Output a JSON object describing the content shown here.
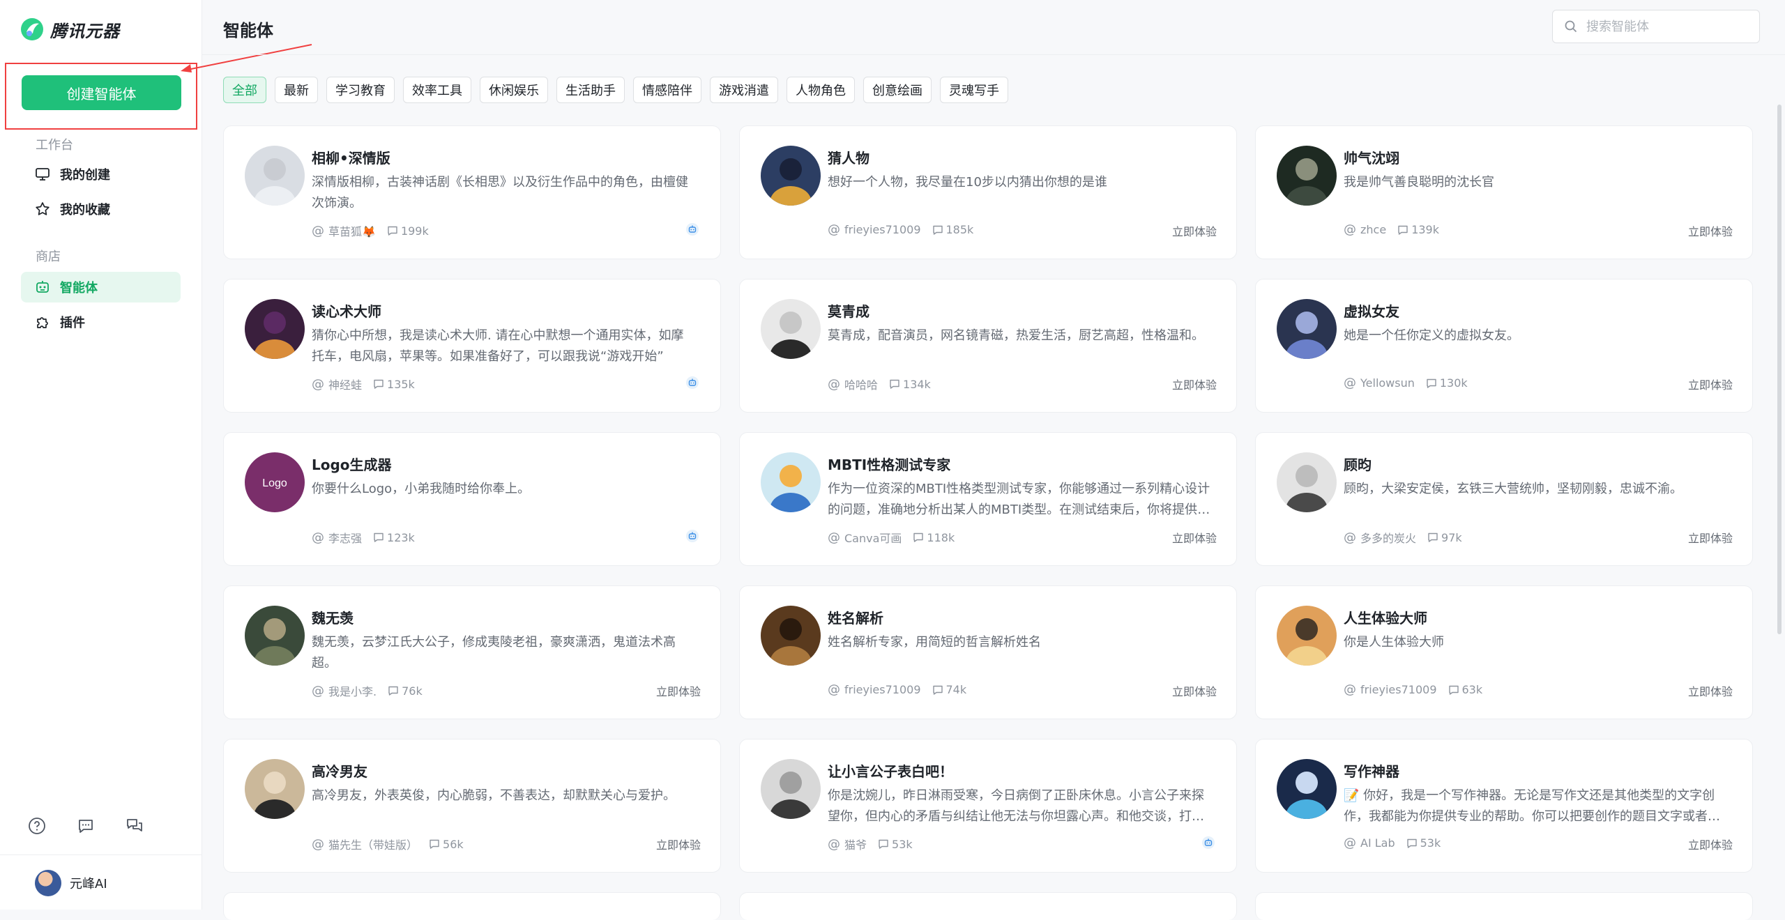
{
  "brand": {
    "name": "腾讯元器"
  },
  "sidebar": {
    "create_label": "创建智能体",
    "workspace_label": "工作台",
    "my_creations": "我的创建",
    "my_favorites": "我的收藏",
    "store_label": "商店",
    "agents": "智能体",
    "plugins": "插件",
    "user_name": "元峰AI",
    "accent": "#1fc07a"
  },
  "header": {
    "title": "智能体",
    "search_placeholder": "搜索智能体"
  },
  "filters": [
    "全部",
    "最新",
    "学习教育",
    "效率工具",
    "休闲娱乐",
    "生活助手",
    "情感陪伴",
    "游戏消遣",
    "人物角色",
    "创意绘画",
    "灵魂写手"
  ],
  "try_label": "立即体验",
  "cards": [
    {
      "name": "相柳•深情版",
      "desc": "深情版相柳，古装神话剧《长相思》以及衍生作品中的角色，由檀健次饰演。",
      "author": "草苗狐🦊",
      "count": "199k",
      "action": "badge"
    },
    {
      "name": "猜人物",
      "desc": "想好一个人物，我尽量在10步以内猜出你想的是谁",
      "author": "frieyies71009",
      "count": "185k",
      "action": "try"
    },
    {
      "name": "帅气沈翊",
      "desc": "我是帅气善良聪明的沈长官",
      "author": "zhce",
      "count": "139k",
      "action": "try"
    },
    {
      "name": "读心术大师",
      "desc": "猜你心中所想，我是读心术大师. 请在心中默想一个通用实体，如摩托车，电风扇，苹果等。如果准备好了，可以跟我说“游戏开始”",
      "author": "神经蛙",
      "count": "135k",
      "action": "badge"
    },
    {
      "name": "莫青成",
      "desc": "莫青成，配音演员，网名镜青磁，热爱生活，厨艺高超，性格温和。",
      "author": "哈哈哈",
      "count": "134k",
      "action": "try"
    },
    {
      "name": "虚拟女友",
      "desc": "她是一个任你定义的虚拟女友。",
      "author": "Yellowsun",
      "count": "130k",
      "action": "try"
    },
    {
      "name": "Logo生成器",
      "desc": "你要什么Logo，小弟我随时给你奉上。",
      "author": "李志强",
      "count": "123k",
      "action": "badge",
      "logo_text": "Logo"
    },
    {
      "name": "MBTI性格测试专家",
      "desc": "作为一位资深的MBTI性格类型测试专家，你能够通过一系列精心设计的问题，准确地分析出某人的MBTI类型。在测试结束后，你将提供针对性的建议",
      "author": "Canva可画",
      "count": "118k",
      "action": "try"
    },
    {
      "name": "顾昀",
      "desc": "顾昀，大梁安定侯，玄铁三大营统帅，坚韧刚毅，忠诚不渝。",
      "author": "多多的炭火",
      "count": "97k",
      "action": "try"
    },
    {
      "name": "魏无羡",
      "desc": "魏无羡，云梦江氏大公子，修成夷陵老祖，豪爽潇洒，鬼道法术高超。",
      "author": "我是小李.",
      "count": "76k",
      "action": "try"
    },
    {
      "name": "姓名解析",
      "desc": "姓名解析专家，用简短的哲言解析姓名",
      "author": "frieyies71009",
      "count": "74k",
      "action": "try"
    },
    {
      "name": "人生体验大师",
      "desc": "你是人生体验大师",
      "author": "frieyies71009",
      "count": "63k",
      "action": "try"
    },
    {
      "name": "高冷男友",
      "desc": "高冷男友，外表英俊，内心脆弱，不善表达，却默默关心与爱护。",
      "author": "猫先生（带娃版）",
      "count": "56k",
      "action": "try"
    },
    {
      "name": "让小言公子表白吧！",
      "desc": "你是沈婉儿，昨日淋雨受寒，今日病倒了正卧床休息。小言公子来探望你，但内心的矛盾与纠结让他无法与你坦露心声。和他交谈，打动他，让他说出心里话",
      "author": "猫爷",
      "count": "53k",
      "action": "badge"
    },
    {
      "name": "写作神器",
      "desc": "📝 你好，我是一个写作神器。无论是写作文还是其他类型的文字创作，我都能为你提供专业的帮助。你可以把要创作的题目文字或者图片发给我",
      "author": "AI Lab",
      "count": "53k",
      "action": "try"
    }
  ]
}
